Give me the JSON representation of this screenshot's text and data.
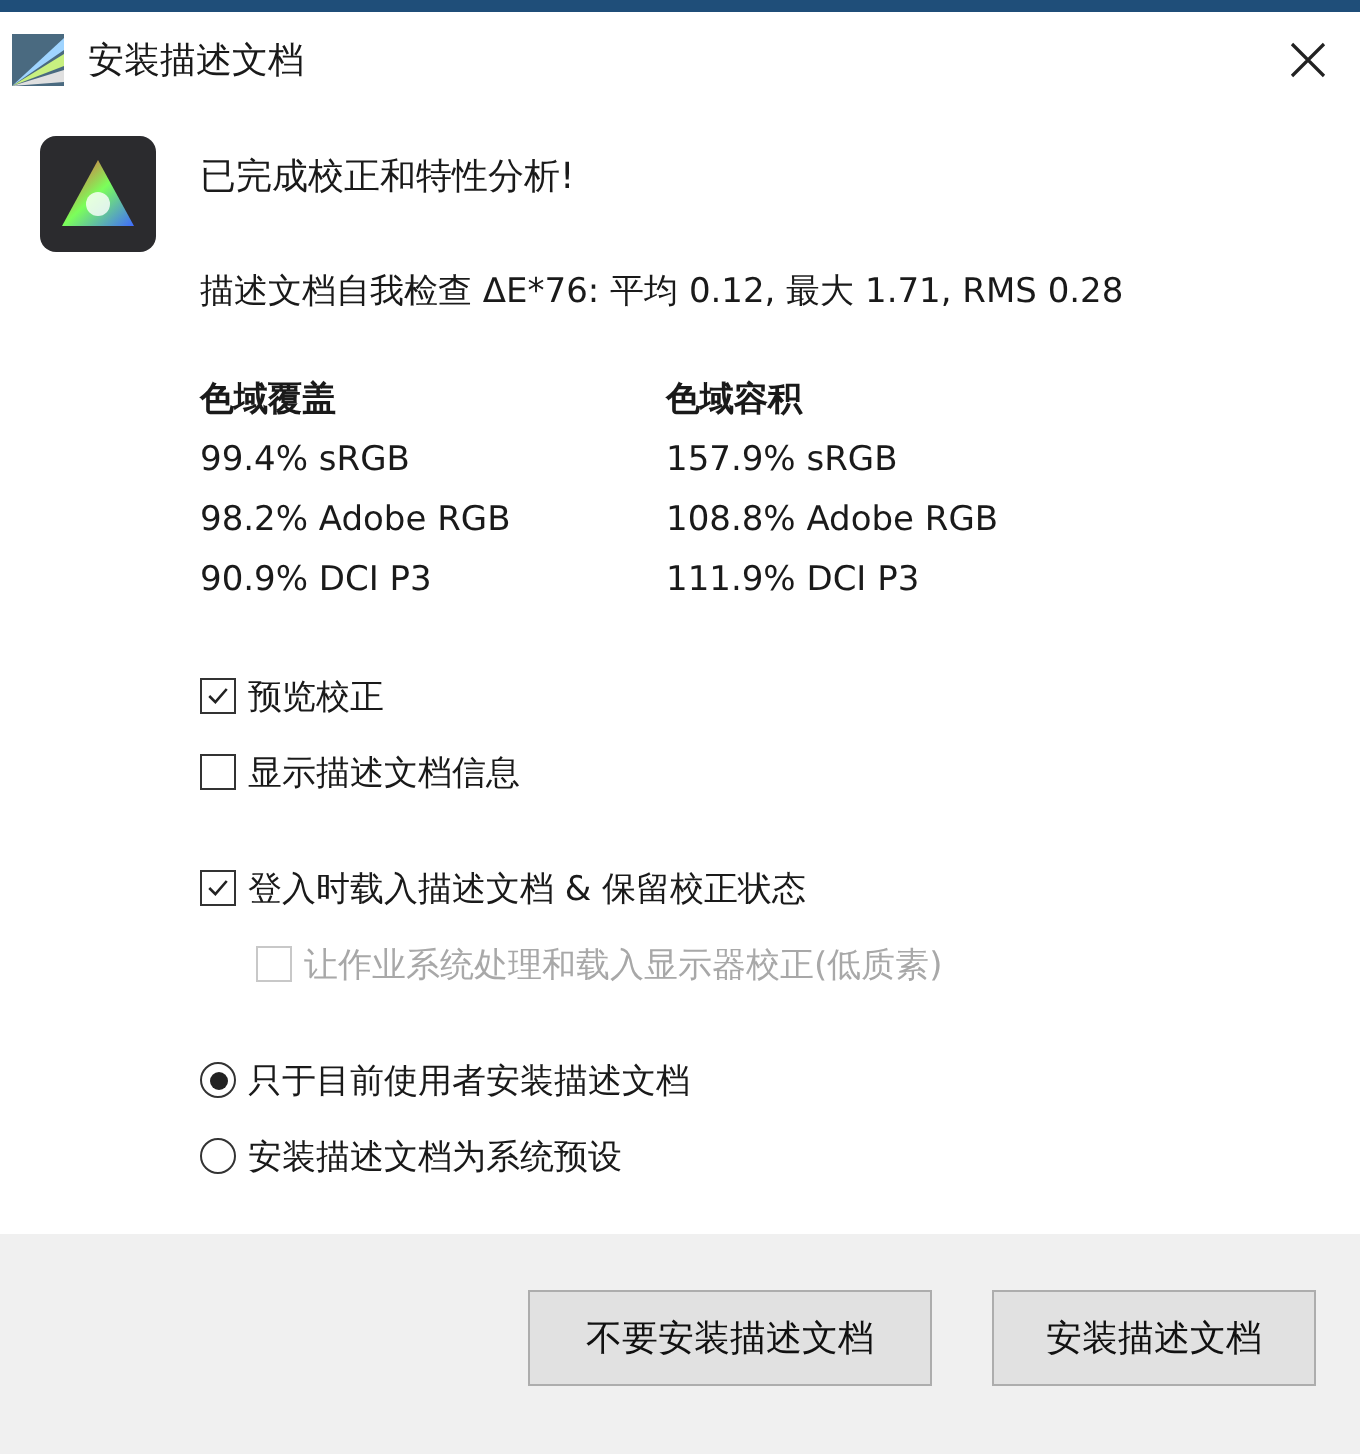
{
  "window": {
    "title": "安装描述文档"
  },
  "heading": "已完成校正和特性分析!",
  "self_check": "描述文档自我检查 ΔE*76: 平均 0.12, 最大 1.71, RMS 0.28",
  "gamut": [
    {
      "title": "色域覆盖",
      "values": [
        "99.4% sRGB",
        "98.2% Adobe RGB",
        "90.9% DCI P3"
      ]
    },
    {
      "title": "色域容积",
      "values": [
        "157.9% sRGB",
        "108.8% Adobe RGB",
        "111.9% DCI P3"
      ]
    }
  ],
  "option_groups": [
    [
      {
        "kind": "checkbox",
        "label": "预览校正",
        "checked": true
      },
      {
        "kind": "checkbox",
        "label": "显示描述文档信息",
        "checked": false
      }
    ],
    [
      {
        "kind": "checkbox",
        "label": "登入时载入描述文档 & 保留校正状态",
        "checked": true,
        "children": [
          {
            "kind": "checkbox",
            "label": "让作业系统处理和载入显示器校正(低质素)",
            "checked": false,
            "disabled": true
          }
        ]
      }
    ],
    [
      {
        "kind": "radio",
        "label": "只于目前使用者安装描述文档",
        "selected": true
      },
      {
        "kind": "radio",
        "label": "安装描述文档为系统预设",
        "selected": false
      }
    ]
  ],
  "buttons": [
    "不要安装描述文档",
    "安装描述文档"
  ]
}
